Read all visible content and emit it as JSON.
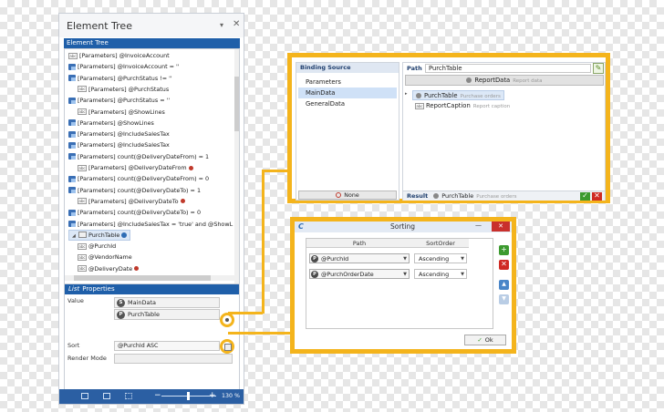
{
  "tree_panel": {
    "title": "Element Tree",
    "pin_glyph": "▾",
    "close_glyph": "✕",
    "header": "Element Tree",
    "rows": [
      {
        "indent": 1,
        "icon": "abc",
        "text": "[Parameters] @InvoiceAccount"
      },
      {
        "indent": 1,
        "icon": "param",
        "text": "[Parameters] @InvoiceAccount = ''"
      },
      {
        "indent": 1,
        "icon": "param",
        "text": "[Parameters] @PurchStatus != ''"
      },
      {
        "indent": 2,
        "icon": "abc",
        "text": "[Parameters] @PurchStatus"
      },
      {
        "indent": 1,
        "icon": "param",
        "text": "[Parameters] @PurchStatus = ''"
      },
      {
        "indent": 2,
        "icon": "abc",
        "text": "[Parameters] @ShowLines"
      },
      {
        "indent": 1,
        "icon": "param",
        "text": "[Parameters] @ShowLines"
      },
      {
        "indent": 1,
        "icon": "param",
        "text": "[Parameters] @IncludeSalesTax"
      },
      {
        "indent": 1,
        "icon": "param",
        "text": "[Parameters] @IncludeSalesTax"
      },
      {
        "indent": 1,
        "icon": "param",
        "text": "[Parameters] count(@DeliveryDateFrom) = 1"
      },
      {
        "indent": 2,
        "icon": "abc",
        "text": "[Parameters] @DeliveryDateFrom",
        "dot": true
      },
      {
        "indent": 1,
        "icon": "param",
        "text": "[Parameters] count(@DeliveryDateFrom) = 0"
      },
      {
        "indent": 1,
        "icon": "param",
        "text": "[Parameters] count(@DeliveryDateTo) = 1"
      },
      {
        "indent": 2,
        "icon": "abc",
        "text": "[Parameters] @DeliveryDateTo",
        "dot": true
      },
      {
        "indent": 1,
        "icon": "param",
        "text": "[Parameters] count(@DeliveryDateTo) = 0"
      },
      {
        "indent": 1,
        "icon": "param",
        "text": "[Parameters] @IncludeSalesTax = 'true' and @ShowL"
      },
      {
        "indent": 1,
        "icon": "table",
        "text": "PurchTable",
        "expander": "◢",
        "selected": true,
        "bluedot": true
      },
      {
        "indent": 2,
        "icon": "abc",
        "text": "@PurchId"
      },
      {
        "indent": 2,
        "icon": "abc",
        "text": "@VendorName"
      },
      {
        "indent": 2,
        "icon": "abc",
        "text": "@DeliveryDate",
        "dot": true
      }
    ],
    "props": {
      "header_icon": "List",
      "header_text": "Properties",
      "value_label": "Value",
      "value_items": [
        {
          "badge": "S",
          "text": "MainData"
        },
        {
          "badge": "P",
          "text": "PurchTable"
        }
      ],
      "sort_label": "Sort",
      "sort_value": "@PurchId ASC",
      "render_label": "Render Mode"
    },
    "status": {
      "zoom_minus": "−",
      "zoom_plus": "+",
      "zoom_level": "130 %"
    }
  },
  "binding": {
    "sources_header": "Binding Source",
    "sources": [
      "Parameters",
      "MainData",
      "GeneralData"
    ],
    "selected_source": 1,
    "none_label": "None",
    "path_label": "Path",
    "path_value": "PurchTable",
    "edit_glyph": "✎",
    "report_label": "ReportData",
    "report_sub": "Report data",
    "node1_label": "PurchTable",
    "node1_sub": "Purchase orders",
    "node2_label": "ReportCaption",
    "node2_sub": "Report caption",
    "result_label": "Result",
    "result_value": "PurchTable",
    "result_sub": "Purchase orders",
    "ok_glyph": "✓",
    "cancel_glyph": "✕"
  },
  "sorting": {
    "title": "Sorting",
    "app_glyph": "C",
    "min_glyph": "—",
    "close_glyph": "✕",
    "col_path": "Path",
    "col_order": "SortOrder",
    "rows": [
      {
        "badge": "P",
        "path": "@PurchId",
        "order": "Ascending"
      },
      {
        "badge": "P",
        "path": "@PurchOrderDate",
        "order": "Ascending"
      }
    ],
    "add_glyph": "+",
    "remove_glyph": "✕",
    "up_glyph": "▲",
    "down_glyph": "▼",
    "ok_label": "Ok",
    "ok_glyph": "✓"
  },
  "colors": {
    "accent": "#f4b41c",
    "header_blue": "#1f5fa9",
    "status_blue": "#2b5fa3"
  }
}
